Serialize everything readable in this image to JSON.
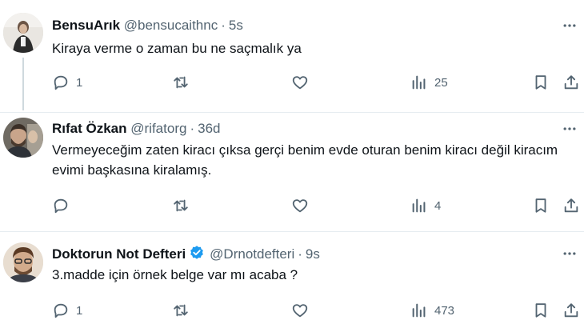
{
  "tweets": [
    {
      "name": "BensuArık",
      "handle": "@bensucaithnc",
      "dot": "·",
      "time": "5s",
      "text": "Kiraya verme o zaman bu ne saçmalık ya",
      "reply_count": "1",
      "repost_count": "",
      "like_count": "",
      "view_count": "25",
      "verified": false
    },
    {
      "name": "Rıfat Özkan",
      "handle": "@rifatorg",
      "dot": "·",
      "time": "36d",
      "text": "Vermeyeceğim zaten kiracı çıksa gerçi benim evde oturan benim kiracı değil kiracım evimi başkasına kiralamış.",
      "reply_count": "",
      "repost_count": "",
      "like_count": "",
      "view_count": "4",
      "verified": false
    },
    {
      "name": "Doktorun Not Defteri",
      "handle": "@Drnotdefteri",
      "dot": "·",
      "time": "9s",
      "text": "3.madde için örnek belge var mı acaba ?",
      "reply_count": "1",
      "repost_count": "",
      "like_count": "",
      "view_count": "473",
      "verified": true
    }
  ],
  "icons": {
    "reply": "reply-icon",
    "repost": "repost-icon",
    "like": "heart-icon",
    "views": "views-icon",
    "bookmark": "bookmark-icon",
    "share": "share-icon",
    "more": "more-icon",
    "verified": "verified-badge-icon"
  },
  "colors": {
    "text": "#0f1419",
    "secondary": "#536471",
    "verified": "#1d9bf0",
    "separator": "#e6ecf0"
  }
}
